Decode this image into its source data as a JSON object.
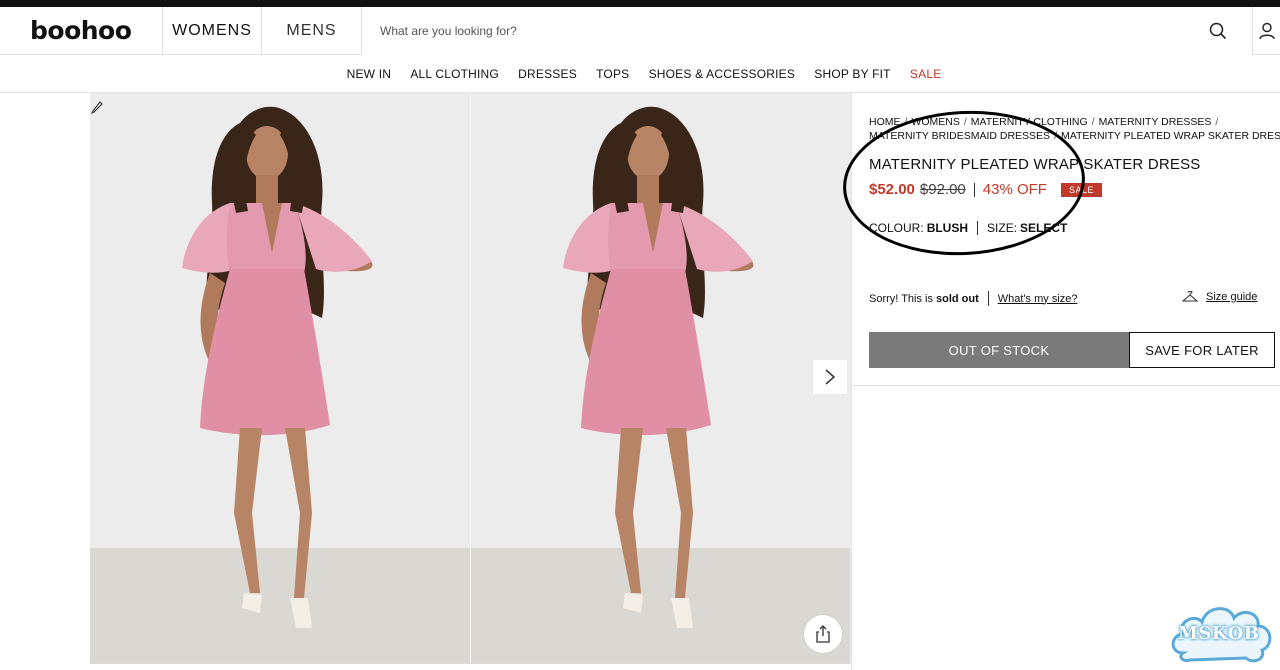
{
  "header": {
    "logo": "boohoo",
    "gender_tabs": [
      "WOMENS",
      "MENS"
    ],
    "search_placeholder": "What are you looking for?"
  },
  "nav": {
    "items": [
      "NEW IN",
      "ALL CLOTHING",
      "DRESSES",
      "TOPS",
      "SHOES & ACCESSORIES",
      "SHOP BY FIT",
      "SALE"
    ]
  },
  "breadcrumb": {
    "items": [
      "HOME",
      "WOMENS",
      "MATERNITY CLOTHING",
      "MATERNITY DRESSES",
      "MATERNITY BRIDESMAID DRESSES",
      "MATERNITY PLEATED WRAP SKATER DRESS"
    ],
    "separator": "/"
  },
  "product": {
    "title": "MATERNITY PLEATED WRAP SKATER DRESS",
    "price_now": "$52.00",
    "price_was": "$92.00",
    "discount": "43% OFF",
    "badge": "SALE",
    "colour_label": "COLOUR:",
    "colour_value": "BLUSH",
    "size_label": "SIZE:",
    "size_value": "SELECT"
  },
  "stock": {
    "prefix": "Sorry! This is",
    "status": "sold out",
    "whats_my_size": "What's my size?",
    "size_guide": "Size guide"
  },
  "actions": {
    "out_of_stock": "OUT OF STOCK",
    "save_for_later": "SAVE FOR LATER"
  },
  "watermark": "MSKOB",
  "colors": {
    "sale_red": "#c0392b",
    "button_grey": "#7a7a7a",
    "dress_pink": "#e49aae",
    "background_grey": "#ececec"
  }
}
